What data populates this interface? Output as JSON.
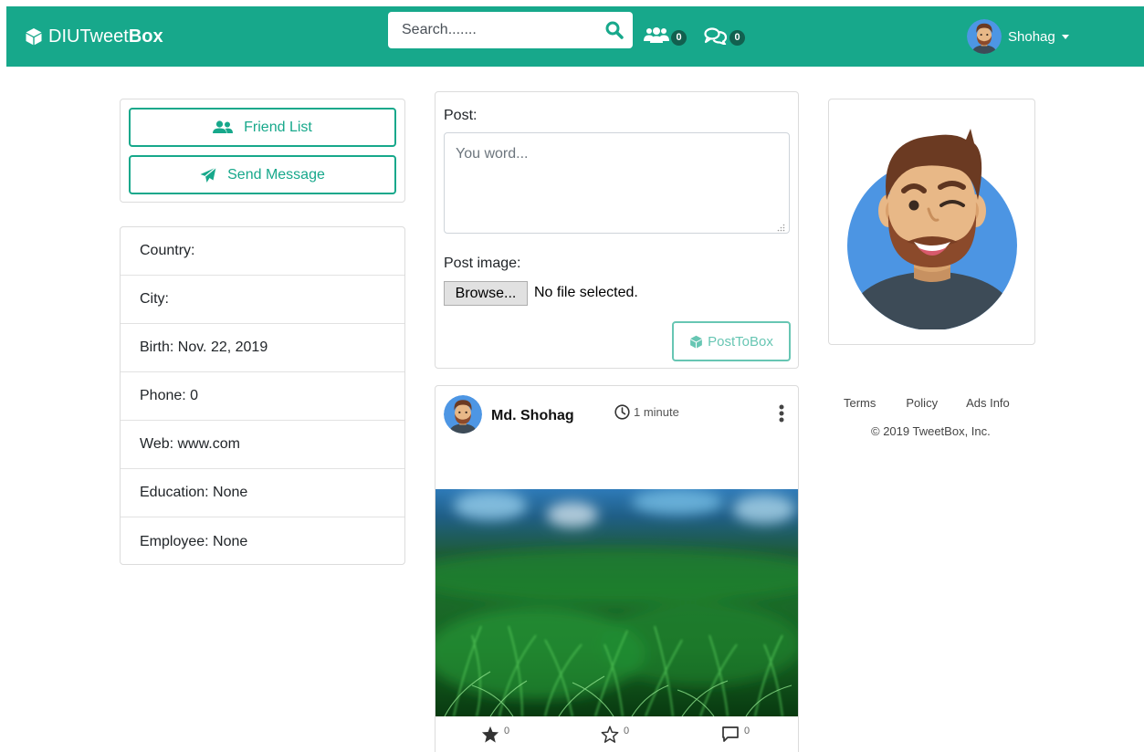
{
  "navbar": {
    "brand_part1": "DIUTweet",
    "brand_part2": "Box",
    "search_placeholder": "Search.......",
    "friends_count": "0",
    "messages_count": "0",
    "username": "Shohag"
  },
  "sidebar": {
    "friend_list_label": "Friend List",
    "send_message_label": "Send Message",
    "info": [
      "Country:",
      "City:",
      "Birth: Nov. 22, 2019",
      "Phone: 0",
      "Web: www.com",
      "Education: None",
      "Employee: None"
    ]
  },
  "composer": {
    "post_label": "Post:",
    "post_placeholder": "You word...",
    "image_label": "Post image:",
    "browse_label": "Browse...",
    "no_file_text": "No file selected.",
    "submit_label": "PostToBox"
  },
  "feed": {
    "posts": [
      {
        "author": "Md. Shohag",
        "time": "1 minute",
        "likes": "0",
        "favorites": "0",
        "comments": "0"
      }
    ]
  },
  "footer": {
    "links": [
      "Terms",
      "Policy",
      "Ads Info"
    ],
    "copyright": "© 2019 TweetBox, Inc."
  },
  "colors": {
    "brand": "#17a88b",
    "badge": "#12604f"
  }
}
